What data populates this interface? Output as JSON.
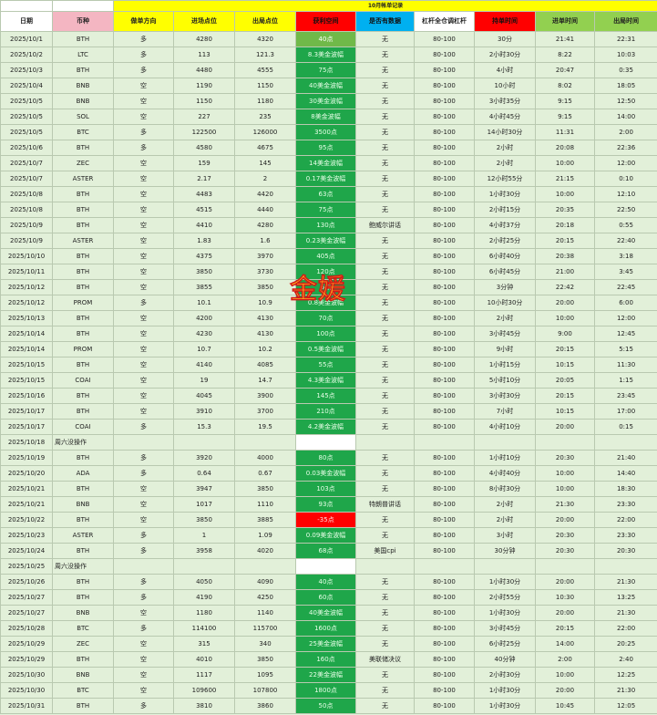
{
  "sheet_title": "10月帐单记录",
  "watermark_text": "金媛",
  "colors": {
    "profit_cell": "#1fa64a",
    "loss_cell": "#ff0000",
    "header_yellow": "#ffff00",
    "header_pink": "#f4b6c2",
    "header_red": "#ff0000",
    "header_blue": "#00b0f0",
    "header_green": "#92d050",
    "sheet_bg": "#e2f0d9"
  },
  "columns": [
    "日期",
    "币种",
    "做单方向",
    "进场点位",
    "出局点位",
    "获利空间",
    "是否有数据",
    "杠杆全仓调杠杆",
    "持单时间",
    "进单时间",
    "出局时间"
  ],
  "rows": [
    {
      "date": "2025/10/1",
      "coin": "BTH",
      "dir": "多",
      "entry": "4280",
      "exit": "4320",
      "profit": "40点",
      "data": "无",
      "lev": "80-100",
      "hold": "30分",
      "in": "21:41",
      "out": "22:31"
    },
    {
      "date": "2025/10/2",
      "coin": "LTC",
      "dir": "多",
      "entry": "113",
      "exit": "121.3",
      "profit": "8.3美金波幅",
      "data": "无",
      "lev": "80-100",
      "hold": "2小时30分",
      "in": "8:22",
      "out": "10:03"
    },
    {
      "date": "2025/10/3",
      "coin": "BTH",
      "dir": "多",
      "entry": "4480",
      "exit": "4555",
      "profit": "75点",
      "data": "无",
      "lev": "80-100",
      "hold": "4小时",
      "in": "20:47",
      "out": "0:35"
    },
    {
      "date": "2025/10/4",
      "coin": "BNB",
      "dir": "空",
      "entry": "1190",
      "exit": "1150",
      "profit": "40美金波幅",
      "data": "无",
      "lev": "80-100",
      "hold": "10小时",
      "in": "8:02",
      "out": "18:05"
    },
    {
      "date": "2025/10/5",
      "coin": "BNB",
      "dir": "空",
      "entry": "1150",
      "exit": "1180",
      "profit": "30美金波幅",
      "data": "无",
      "lev": "80-100",
      "hold": "3小时35分",
      "in": "9:15",
      "out": "12:50"
    },
    {
      "date": "2025/10/5",
      "coin": "SOL",
      "dir": "空",
      "entry": "227",
      "exit": "235",
      "profit": "8美金波幅",
      "data": "无",
      "lev": "80-100",
      "hold": "4小时45分",
      "in": "9:15",
      "out": "14:00"
    },
    {
      "date": "2025/10/5",
      "coin": "BTC",
      "dir": "多",
      "entry": "122500",
      "exit": "126000",
      "profit": "3500点",
      "data": "无",
      "lev": "80-100",
      "hold": "14小时30分",
      "in": "11:31",
      "out": "2:00"
    },
    {
      "date": "2025/10/6",
      "coin": "BTH",
      "dir": "多",
      "entry": "4580",
      "exit": "4675",
      "profit": "95点",
      "data": "无",
      "lev": "80-100",
      "hold": "2小时",
      "in": "20:08",
      "out": "22:36"
    },
    {
      "date": "2025/10/7",
      "coin": "ZEC",
      "dir": "空",
      "entry": "159",
      "exit": "145",
      "profit": "14美金波幅",
      "data": "无",
      "lev": "80-100",
      "hold": "2小时",
      "in": "10:00",
      "out": "12:00"
    },
    {
      "date": "2025/10/7",
      "coin": "ASTER",
      "dir": "空",
      "entry": "2.17",
      "exit": "2",
      "profit": "0.17美金波幅",
      "data": "无",
      "lev": "80-100",
      "hold": "12小时55分",
      "in": "21:15",
      "out": "0:10"
    },
    {
      "date": "2025/10/8",
      "coin": "BTH",
      "dir": "空",
      "entry": "4483",
      "exit": "4420",
      "profit": "63点",
      "data": "无",
      "lev": "80-100",
      "hold": "1小时30分",
      "in": "10:00",
      "out": "12:10"
    },
    {
      "date": "2025/10/8",
      "coin": "BTH",
      "dir": "空",
      "entry": "4515",
      "exit": "4440",
      "profit": "75点",
      "data": "无",
      "lev": "80-100",
      "hold": "2小时15分",
      "in": "20:35",
      "out": "22:50"
    },
    {
      "date": "2025/10/9",
      "coin": "BTH",
      "dir": "空",
      "entry": "4410",
      "exit": "4280",
      "profit": "130点",
      "data": "鲍威尔讲话",
      "lev": "80-100",
      "hold": "4小时37分",
      "in": "20:18",
      "out": "0:55"
    },
    {
      "date": "2025/10/9",
      "coin": "ASTER",
      "dir": "空",
      "entry": "1.83",
      "exit": "1.6",
      "profit": "0.23美金波幅",
      "data": "无",
      "lev": "80-100",
      "hold": "2小时25分",
      "in": "20:15",
      "out": "22:40"
    },
    {
      "date": "2025/10/10",
      "coin": "BTH",
      "dir": "空",
      "entry": "4375",
      "exit": "3970",
      "profit": "405点",
      "data": "无",
      "lev": "80-100",
      "hold": "6小时40分",
      "in": "20:38",
      "out": "3:18"
    },
    {
      "date": "2025/10/11",
      "coin": "BTH",
      "dir": "空",
      "entry": "3850",
      "exit": "3730",
      "profit": "120点",
      "data": "无",
      "lev": "80-100",
      "hold": "6小时45分",
      "in": "21:00",
      "out": "3:45"
    },
    {
      "date": "2025/10/12",
      "coin": "BTH",
      "dir": "空",
      "entry": "3855",
      "exit": "3850",
      "profit": "5点",
      "data": "无",
      "lev": "80-100",
      "hold": "3分钟",
      "in": "22:42",
      "out": "22:45"
    },
    {
      "date": "2025/10/12",
      "coin": "PROM",
      "dir": "多",
      "entry": "10.1",
      "exit": "10.9",
      "profit": "0.8美金波幅",
      "data": "无",
      "lev": "80-100",
      "hold": "10小时30分",
      "in": "20:00",
      "out": "6:00"
    },
    {
      "date": "2025/10/13",
      "coin": "BTH",
      "dir": "空",
      "entry": "4200",
      "exit": "4130",
      "profit": "70点",
      "data": "无",
      "lev": "80-100",
      "hold": "2小时",
      "in": "10:00",
      "out": "12:00"
    },
    {
      "date": "2025/10/14",
      "coin": "BTH",
      "dir": "空",
      "entry": "4230",
      "exit": "4130",
      "profit": "100点",
      "data": "无",
      "lev": "80-100",
      "hold": "3小时45分",
      "in": "9:00",
      "out": "12:45"
    },
    {
      "date": "2025/10/14",
      "coin": "PROM",
      "dir": "空",
      "entry": "10.7",
      "exit": "10.2",
      "profit": "0.5美金波幅",
      "data": "无",
      "lev": "80-100",
      "hold": "9小时",
      "in": "20:15",
      "out": "5:15"
    },
    {
      "date": "2025/10/15",
      "coin": "BTH",
      "dir": "空",
      "entry": "4140",
      "exit": "4085",
      "profit": "55点",
      "data": "无",
      "lev": "80-100",
      "hold": "1小时15分",
      "in": "10:15",
      "out": "11:30"
    },
    {
      "date": "2025/10/15",
      "coin": "COAI",
      "dir": "空",
      "entry": "19",
      "exit": "14.7",
      "profit": "4.3美金波幅",
      "data": "无",
      "lev": "80-100",
      "hold": "5小时10分",
      "in": "20:05",
      "out": "1:15"
    },
    {
      "date": "2025/10/16",
      "coin": "BTH",
      "dir": "空",
      "entry": "4045",
      "exit": "3900",
      "profit": "145点",
      "data": "无",
      "lev": "80-100",
      "hold": "3小时30分",
      "in": "20:15",
      "out": "23:45"
    },
    {
      "date": "2025/10/17",
      "coin": "BTH",
      "dir": "空",
      "entry": "3910",
      "exit": "3700",
      "profit": "210点",
      "data": "无",
      "lev": "80-100",
      "hold": "7小时",
      "in": "10:15",
      "out": "17:00"
    },
    {
      "date": "2025/10/17",
      "coin": "COAI",
      "dir": "多",
      "entry": "15.3",
      "exit": "19.5",
      "profit": "4.2美金波幅",
      "data": "无",
      "lev": "80-100",
      "hold": "4小时10分",
      "in": "20:00",
      "out": "0:15"
    },
    {
      "date": "2025/10/18",
      "coin": "周六没操作",
      "dir": "",
      "entry": "",
      "exit": "",
      "profit": "",
      "data": "",
      "lev": "",
      "hold": "",
      "in": "",
      "out": ""
    },
    {
      "date": "2025/10/19",
      "coin": "BTH",
      "dir": "多",
      "entry": "3920",
      "exit": "4000",
      "profit": "80点",
      "data": "无",
      "lev": "80-100",
      "hold": "1小时10分",
      "in": "20:30",
      "out": "21:40"
    },
    {
      "date": "2025/10/20",
      "coin": "ADA",
      "dir": "多",
      "entry": "0.64",
      "exit": "0.67",
      "profit": "0.03美金波幅",
      "data": "无",
      "lev": "80-100",
      "hold": "4小时40分",
      "in": "10:00",
      "out": "14:40"
    },
    {
      "date": "2025/10/21",
      "coin": "BTH",
      "dir": "空",
      "entry": "3947",
      "exit": "3850",
      "profit": "103点",
      "data": "无",
      "lev": "80-100",
      "hold": "8小时30分",
      "in": "10:00",
      "out": "18:30"
    },
    {
      "date": "2025/10/21",
      "coin": "BNB",
      "dir": "空",
      "entry": "1017",
      "exit": "1110",
      "profit": "93点",
      "data": "特朗普讲话",
      "lev": "80-100",
      "hold": "2小时",
      "in": "21:30",
      "out": "23:30"
    },
    {
      "date": "2025/10/22",
      "coin": "BTH",
      "dir": "空",
      "entry": "3850",
      "exit": "3885",
      "profit": "-35点",
      "data": "无",
      "lev": "80-100",
      "hold": "2小时",
      "in": "20:00",
      "out": "22:00"
    },
    {
      "date": "2025/10/23",
      "coin": "ASTER",
      "dir": "多",
      "entry": "1",
      "exit": "1.09",
      "profit": "0.09美金波幅",
      "data": "无",
      "lev": "80-100",
      "hold": "3小时",
      "in": "20:30",
      "out": "23:30"
    },
    {
      "date": "2025/10/24",
      "coin": "BTH",
      "dir": "多",
      "entry": "3958",
      "exit": "4020",
      "profit": "68点",
      "data": "美国cpi",
      "lev": "80-100",
      "hold": "30分钟",
      "in": "20:30",
      "out": "20:30"
    },
    {
      "date": "2025/10/25",
      "coin": "周六没操作",
      "dir": "",
      "entry": "",
      "exit": "",
      "profit": "",
      "data": "",
      "lev": "",
      "hold": "",
      "in": "",
      "out": ""
    },
    {
      "date": "2025/10/26",
      "coin": "BTH",
      "dir": "多",
      "entry": "4050",
      "exit": "4090",
      "profit": "40点",
      "data": "无",
      "lev": "80-100",
      "hold": "1小时30分",
      "in": "20:00",
      "out": "21:30"
    },
    {
      "date": "2025/10/27",
      "coin": "BTH",
      "dir": "多",
      "entry": "4190",
      "exit": "4250",
      "profit": "60点",
      "data": "无",
      "lev": "80-100",
      "hold": "2小时55分",
      "in": "10:30",
      "out": "13:25"
    },
    {
      "date": "2025/10/27",
      "coin": "BNB",
      "dir": "空",
      "entry": "1180",
      "exit": "1140",
      "profit": "40美金波幅",
      "data": "无",
      "lev": "80-100",
      "hold": "1小时30分",
      "in": "20:00",
      "out": "21:30"
    },
    {
      "date": "2025/10/28",
      "coin": "BTC",
      "dir": "多",
      "entry": "114100",
      "exit": "115700",
      "profit": "1600点",
      "data": "无",
      "lev": "80-100",
      "hold": "3小时45分",
      "in": "20:15",
      "out": "22:00"
    },
    {
      "date": "2025/10/29",
      "coin": "ZEC",
      "dir": "空",
      "entry": "315",
      "exit": "340",
      "profit": "25美金波幅",
      "data": "无",
      "lev": "80-100",
      "hold": "6小时25分",
      "in": "14:00",
      "out": "20:25"
    },
    {
      "date": "2025/10/29",
      "coin": "BTH",
      "dir": "空",
      "entry": "4010",
      "exit": "3850",
      "profit": "160点",
      "data": "美联储决议",
      "lev": "80-100",
      "hold": "40分钟",
      "in": "2:00",
      "out": "2:40"
    },
    {
      "date": "2025/10/30",
      "coin": "BNB",
      "dir": "空",
      "entry": "1117",
      "exit": "1095",
      "profit": "22美金波幅",
      "data": "无",
      "lev": "80-100",
      "hold": "2小时30分",
      "in": "10:00",
      "out": "12:25"
    },
    {
      "date": "2025/10/30",
      "coin": "BTC",
      "dir": "空",
      "entry": "109600",
      "exit": "107800",
      "profit": "1800点",
      "data": "无",
      "lev": "80-100",
      "hold": "1小时30分",
      "in": "20:00",
      "out": "21:30"
    },
    {
      "date": "2025/10/31",
      "coin": "BTH",
      "dir": "多",
      "entry": "3810",
      "exit": "3860",
      "profit": "50点",
      "data": "无",
      "lev": "80-100",
      "hold": "1小时30分",
      "in": "10:45",
      "out": "12:05"
    }
  ]
}
